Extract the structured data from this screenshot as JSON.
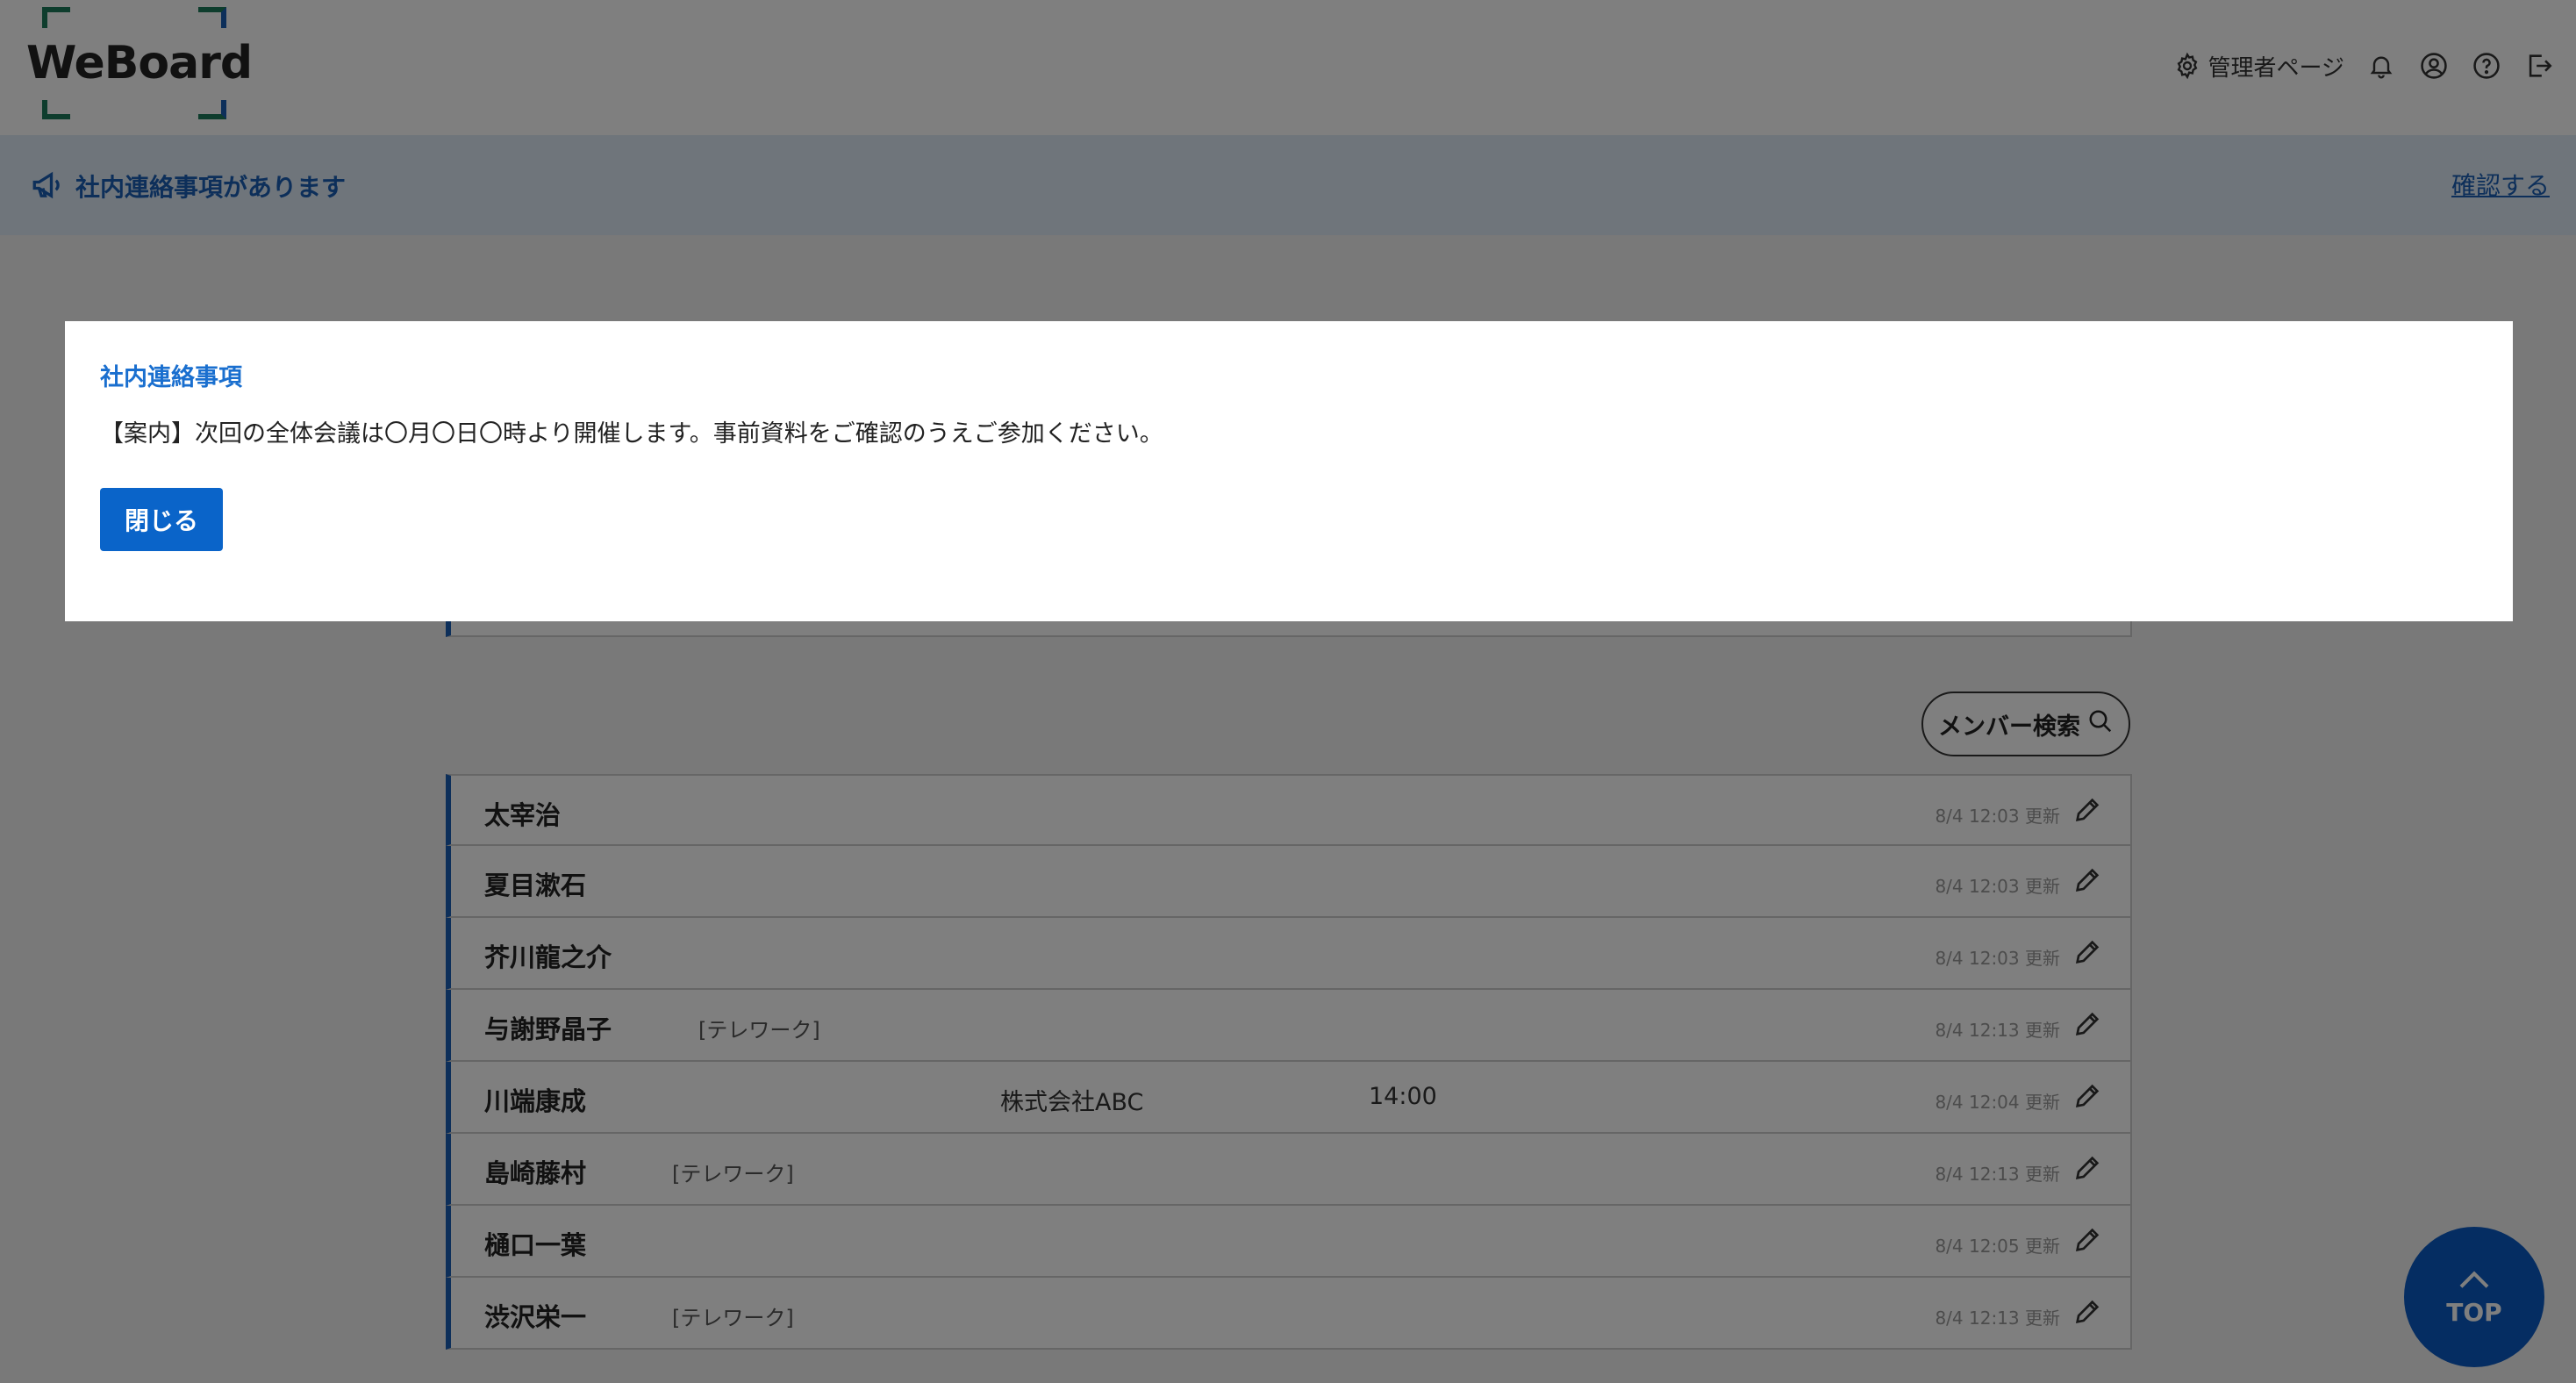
{
  "header": {
    "logo_text": "WeBoard",
    "admin_label": "管理者ページ"
  },
  "notice_bar": {
    "label": "社内連絡事項があります",
    "confirm_label": "確認する"
  },
  "member_search_label": "メンバー検索",
  "members": [
    {
      "name": "太宰治",
      "status": "",
      "place": "",
      "time": "",
      "updated": "8/4 12:03 更新"
    },
    {
      "name": "夏目漱石",
      "status": "",
      "place": "",
      "time": "",
      "updated": "8/4 12:03 更新"
    },
    {
      "name": "芥川龍之介",
      "status": "",
      "place": "",
      "time": "",
      "updated": "8/4 12:03 更新"
    },
    {
      "name": "与謝野晶子",
      "status": "[テレワーク]",
      "place": "",
      "time": "",
      "updated": "8/4 12:13 更新"
    },
    {
      "name": "川端康成",
      "status": "",
      "place": "株式会社ABC",
      "time": "14:00",
      "updated": "8/4 12:04 更新"
    },
    {
      "name": "島崎藤村",
      "status": "[テレワーク]",
      "place": "",
      "time": "",
      "updated": "8/4 12:13 更新"
    },
    {
      "name": "樋口一葉",
      "status": "",
      "place": "",
      "time": "",
      "updated": "8/4 12:05 更新"
    },
    {
      "name": "渋沢栄一",
      "status": "[テレワーク]",
      "place": "",
      "time": "",
      "updated": "8/4 12:13 更新"
    }
  ],
  "top_button_label": "TOP",
  "modal": {
    "title": "社内連絡事項",
    "body": "【案内】次回の全体会議は〇月〇日〇時より開催します。事前資料をご確認のうえご参加ください。",
    "close_label": "閉じる"
  },
  "colors": {
    "accent": "#1a5fb4",
    "button": "#0a64c9",
    "notice_bg": "#dfeaf7"
  }
}
